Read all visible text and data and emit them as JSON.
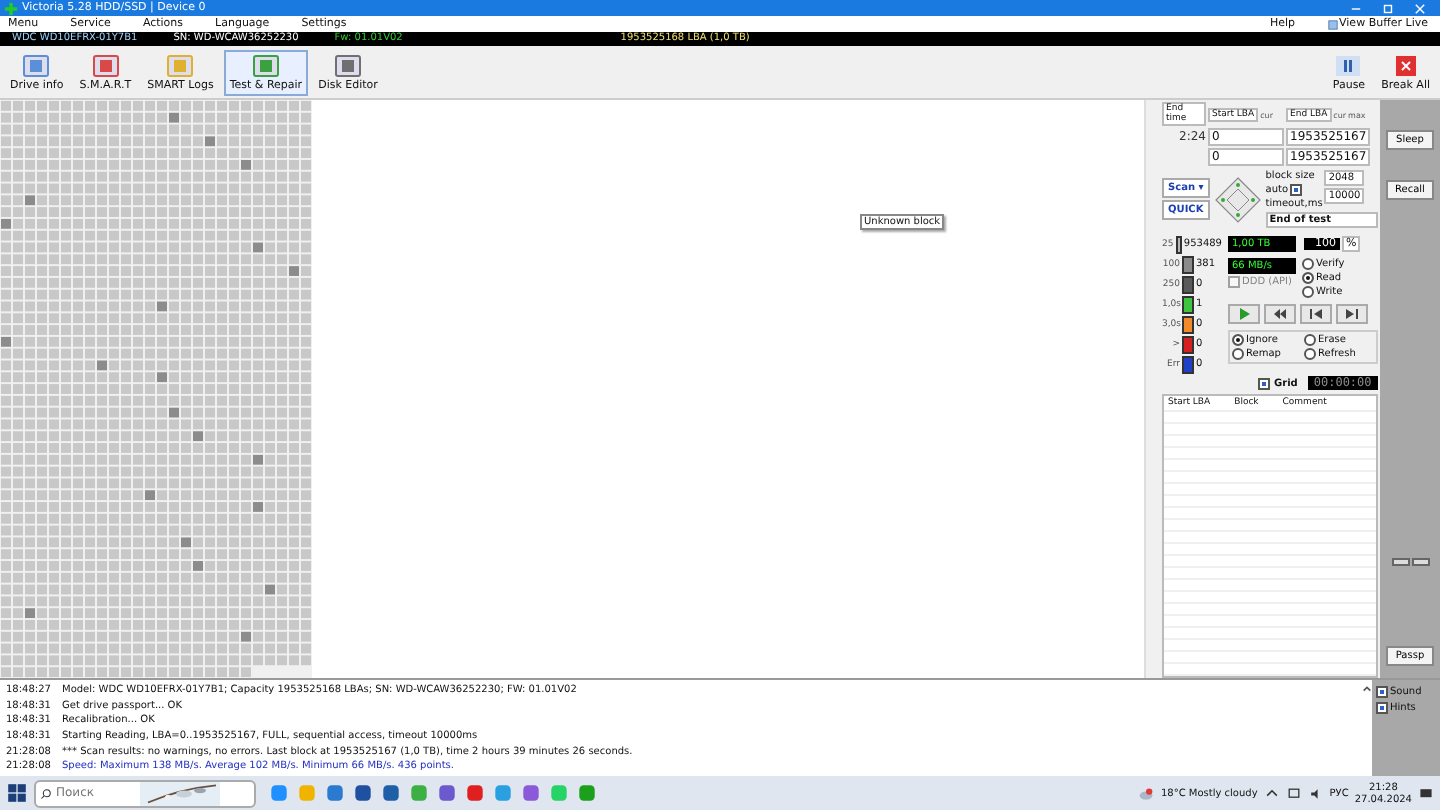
{
  "window": {
    "title": "Victoria 5.28 HDD/SSD | Device 0"
  },
  "menu": [
    "Menu",
    "Service",
    "Actions",
    "Language",
    "Settings"
  ],
  "menu_right": {
    "help": "Help",
    "buffer": "View Buffer Live"
  },
  "drive_bar": {
    "model": "WDC WD10EFRX-01Y7B1",
    "serial": "SN: WD-WCAW36252230",
    "firmware": "Fw: 01.01V02",
    "capacity": "1953525168 LBA (1,0 TB)"
  },
  "toolbar": [
    {
      "label": "Drive info",
      "selected": false
    },
    {
      "label": "S.M.A.R.T",
      "selected": false
    },
    {
      "label": "SMART Logs",
      "selected": false
    },
    {
      "label": "Test & Repair",
      "selected": true
    },
    {
      "label": "Disk Editor",
      "selected": false
    }
  ],
  "toolbar_right": {
    "pause": "Pause",
    "break": "Break All"
  },
  "tooltip": "Unknown block",
  "test": {
    "end_time_label": "End time",
    "end_time": "2:24",
    "start_label": "Start LBA",
    "end_label": "End LBA",
    "start_cur_tag": "cur",
    "end_cur_tag": "cur",
    "max": "max",
    "start_lba": "0",
    "start_cur": "0",
    "end_lba": "1953525167",
    "end_cur": "1953525167",
    "mode": "Scan",
    "mode_arrow": "▾",
    "quick": "QUICK",
    "block_size_label": "block size",
    "auto_label": "auto",
    "auto": true,
    "timeout_label": "timeout,ms",
    "block_size": "2048",
    "timeout": "10000",
    "end_action": "End of test"
  },
  "stats": [
    {
      "label": "25",
      "value": "953489",
      "color": "#b8b8b8"
    },
    {
      "label": "100",
      "value": "381",
      "color": "#8a8a8a"
    },
    {
      "label": "250",
      "value": "0",
      "color": "#5a5a5a"
    },
    {
      "label": "1,0s",
      "value": "1",
      "color": "#3ec43e"
    },
    {
      "label": "3,0s",
      "value": "0",
      "color": "#f08a2a"
    },
    {
      "label": ">",
      "value": "0",
      "color": "#d42020"
    },
    {
      "label": "Err",
      "value": "0",
      "color": "#2040c8"
    }
  ],
  "progress": {
    "size": "1,00 TB",
    "percent": "100",
    "percent_unit": "%",
    "speed": "66 MB/s"
  },
  "ddd": {
    "label": "DDD (API)",
    "checked": false,
    "disabled": true
  },
  "access": [
    {
      "label": "Verify",
      "selected": false
    },
    {
      "label": "Read",
      "selected": true
    },
    {
      "label": "Write",
      "selected": false
    }
  ],
  "repair": [
    {
      "label": "Ignore",
      "selected": true
    },
    {
      "label": "Erase",
      "selected": false
    },
    {
      "label": "Remap",
      "selected": false
    },
    {
      "label": "Refresh",
      "selected": false
    }
  ],
  "grid": {
    "label": "Grid",
    "checked": true,
    "timer": "00:00:00"
  },
  "table": {
    "columns": [
      "Start LBA",
      "Block",
      "Comment"
    ]
  },
  "side_buttons": {
    "sleep": "Sleep",
    "recall": "Recall",
    "passp": "Passp"
  },
  "options": [
    {
      "label": "Sound",
      "checked": true
    },
    {
      "label": "Hints",
      "checked": true
    }
  ],
  "log": [
    {
      "time": "18:48:27",
      "text": "Model: WDC WD10EFRX-01Y7B1; Capacity 1953525168 LBAs; SN: WD-WCAW36252230; FW: 01.01V02",
      "kind": "info"
    },
    {
      "time": "18:48:31",
      "text": "Get drive passport... OK",
      "kind": "info"
    },
    {
      "time": "18:48:31",
      "text": "Recalibration... OK",
      "kind": "info"
    },
    {
      "time": "18:48:31",
      "text": "Starting Reading, LBA=0..1953525167, FULL, sequential access, timeout 10000ms",
      "kind": "info"
    },
    {
      "time": "21:28:08",
      "text": "*** Scan results: no warnings, no errors. Last block at 1953525167 (1,0 TB), time 2 hours 39 minutes 26 seconds.",
      "kind": "info"
    },
    {
      "time": "21:28:08",
      "text": "Speed: Maximum 138 MB/s. Average 102 MB/s. Minimum 66 MB/s. 436 points.",
      "kind": "speed"
    }
  ],
  "taskbar": {
    "search_placeholder": "Поиск",
    "weather": "18°C  Mostly cloudy",
    "lang": "РУС",
    "time": "21:28",
    "date": "27.04.2024"
  }
}
